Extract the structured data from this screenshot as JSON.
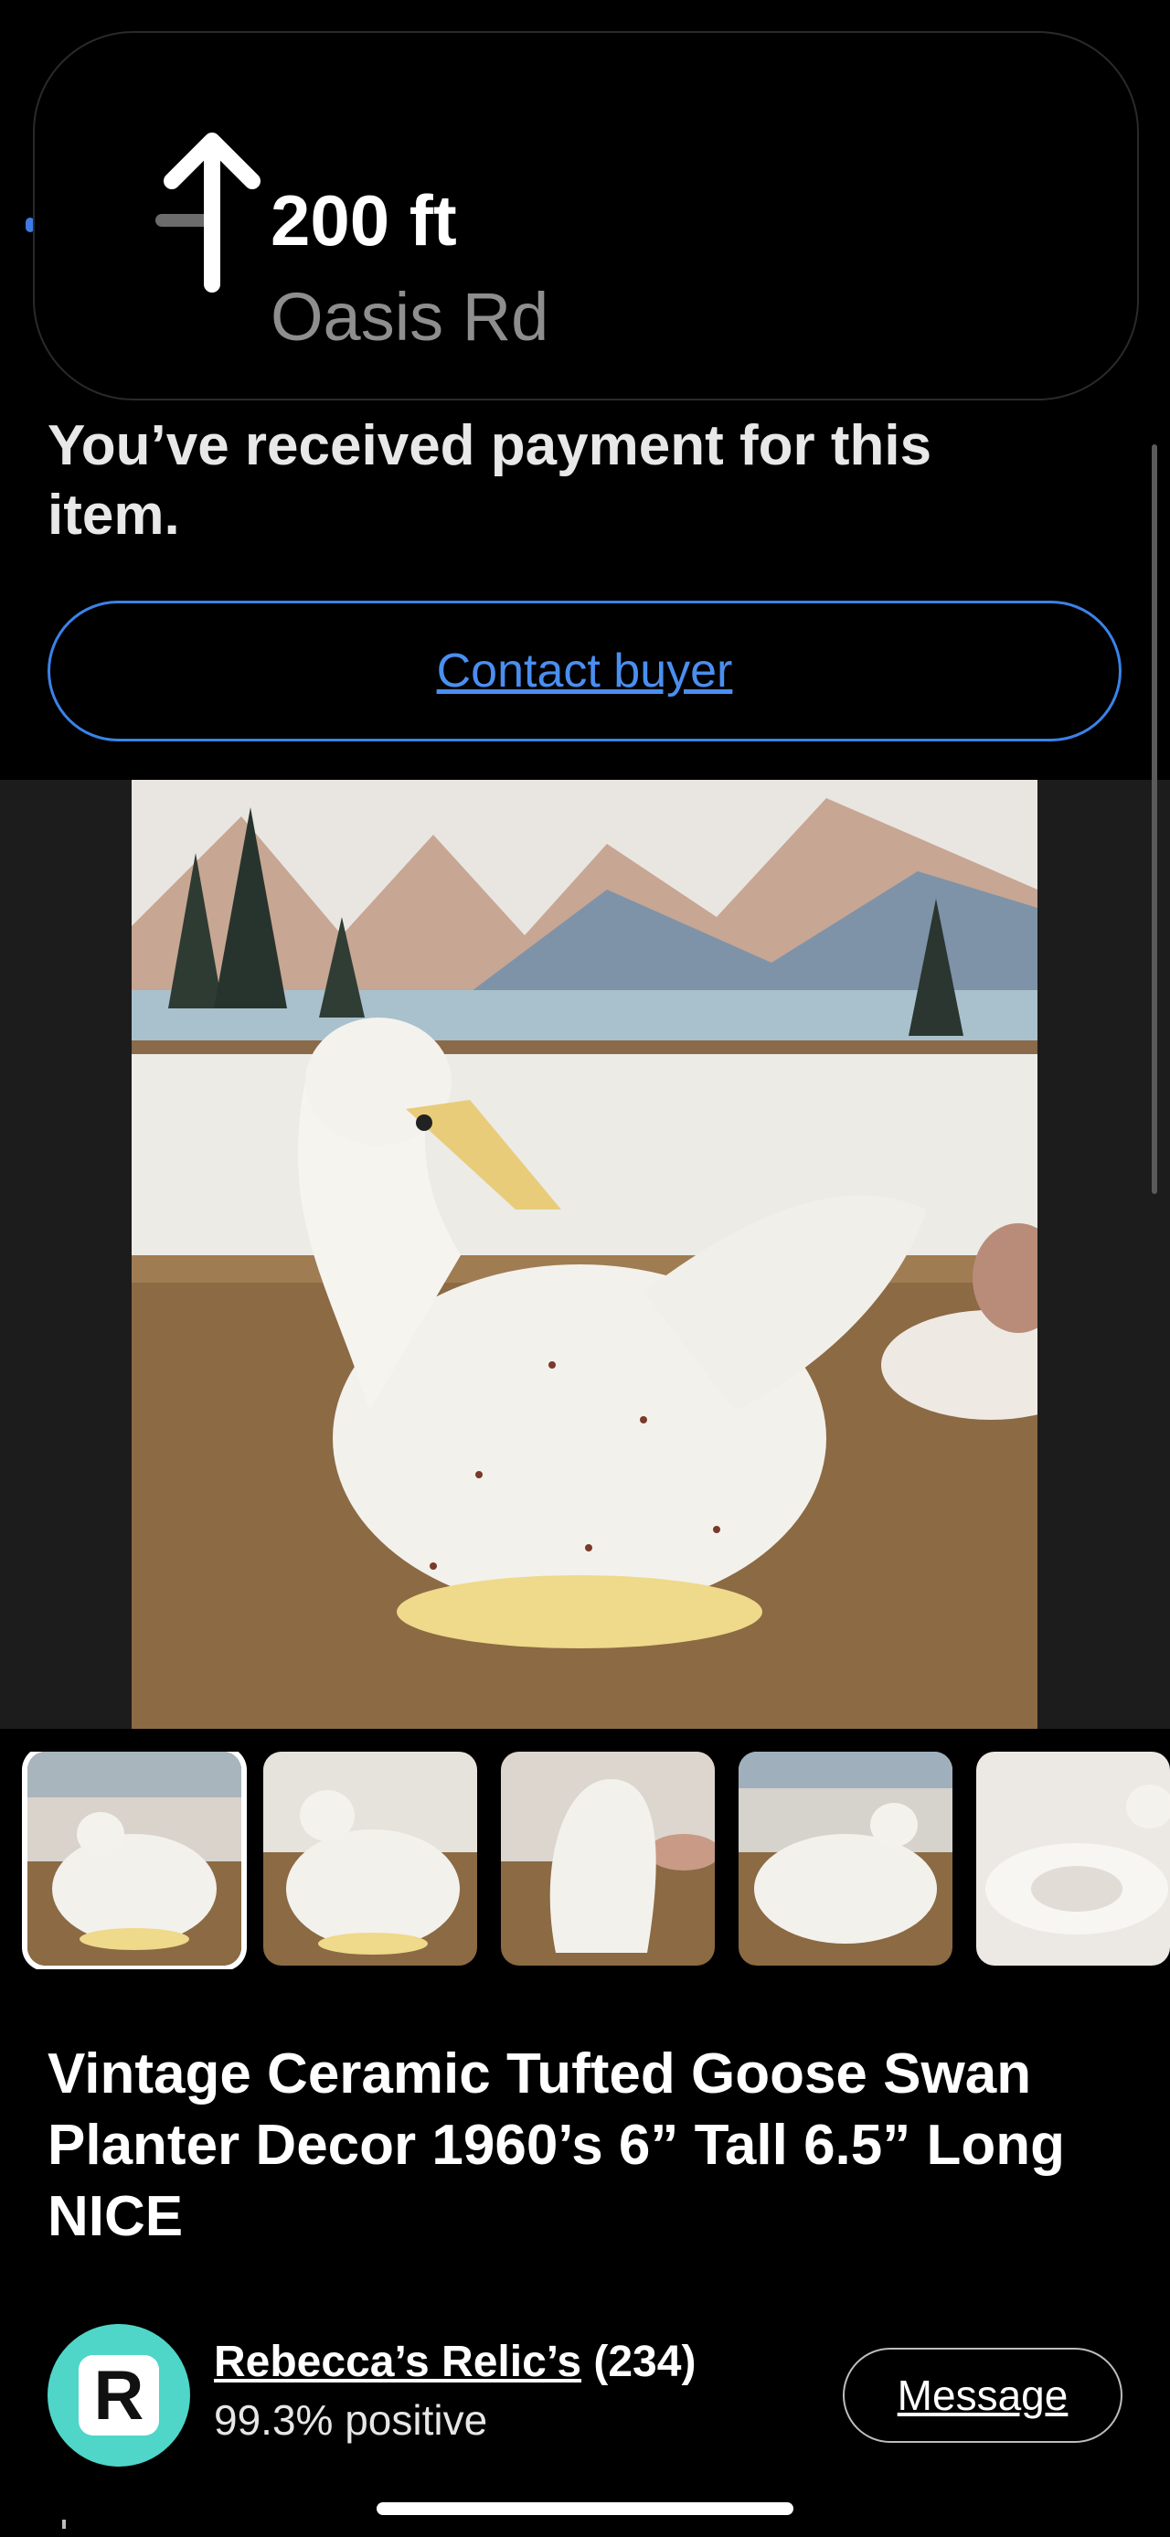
{
  "navigation": {
    "distance": "200 ft",
    "street": "Oasis Rd",
    "direction_icon": "arrow-up-icon"
  },
  "order": {
    "payment_message": "You’ve received payment for this item.",
    "contact_button_label": "Contact buyer"
  },
  "gallery": {
    "thumbnail_count": 5,
    "selected_index": 0
  },
  "listing": {
    "title": "Vintage Ceramic Tufted Goose Swan Planter Decor 1960’s 6” Tall 6.5” Long NICE"
  },
  "seller": {
    "avatar_letter": "R",
    "name": "Rebecca’s Relic’s",
    "feedback_count": "(234)",
    "rating": "99.3% positive",
    "message_button_label": "Message"
  },
  "colors": {
    "accent_blue": "#3b82e8",
    "avatar_teal": "#4fd6c8",
    "background": "#000000"
  }
}
